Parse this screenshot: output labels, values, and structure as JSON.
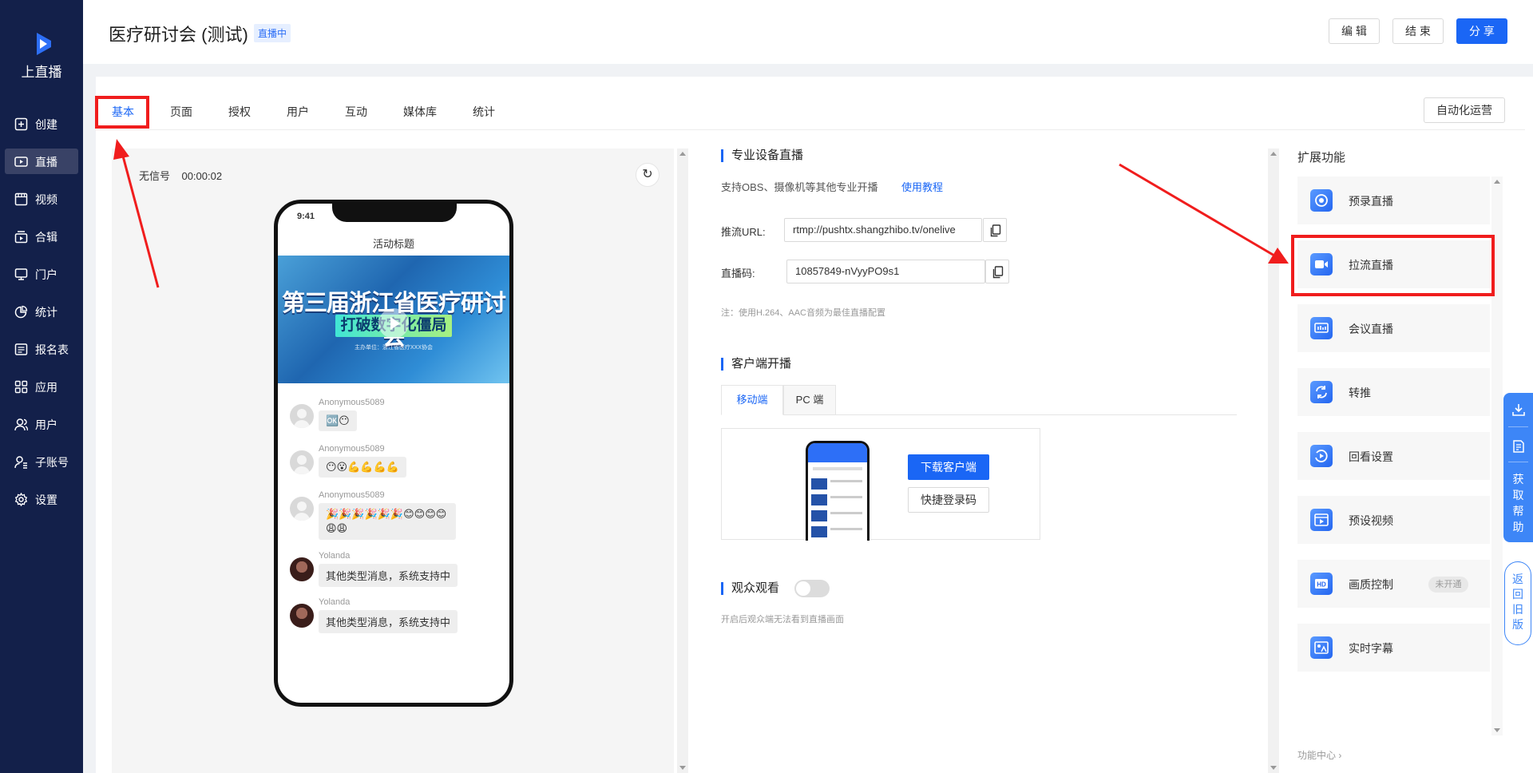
{
  "brand": {
    "name": "上直播"
  },
  "sidebar": {
    "items": [
      {
        "label": "创建",
        "icon": "plus-square-icon"
      },
      {
        "label": "直播",
        "icon": "video-icon",
        "active": true
      },
      {
        "label": "视频",
        "icon": "film-icon"
      },
      {
        "label": "合辑",
        "icon": "collection-icon"
      },
      {
        "label": "门户",
        "icon": "monitor-icon"
      },
      {
        "label": "统计",
        "icon": "pie-chart-icon"
      },
      {
        "label": "报名表",
        "icon": "form-icon"
      },
      {
        "label": "应用",
        "icon": "apps-icon"
      },
      {
        "label": "用户",
        "icon": "users-icon"
      },
      {
        "label": "子账号",
        "icon": "sub-account-icon"
      },
      {
        "label": "设置",
        "icon": "gear-icon"
      }
    ]
  },
  "header": {
    "title": "医疗研讨会 (测试)",
    "status_badge": "直播中",
    "edit_label": "编 辑",
    "end_label": "结 束",
    "share_label": "分 享"
  },
  "tabs": [
    "基本",
    "页面",
    "授权",
    "用户",
    "互动",
    "媒体库",
    "统计"
  ],
  "active_tab": "基本",
  "auto_ops_label": "自动化运营",
  "preview": {
    "signal_status": "无信号",
    "duration": "00:00:02",
    "phone_time": "9:41",
    "activity_title": "活动标题",
    "banner": {
      "title": "第三届浙江省医疗研讨会",
      "subtitle": "打破数字化僵局",
      "host_line": "主办单位：浙江省医疗XXX协会"
    },
    "messages": [
      {
        "name": "Anonymous5089",
        "content": "🆗😶"
      },
      {
        "name": "Anonymous5089",
        "content": "😶😮💪💪💪💪"
      },
      {
        "name": "Anonymous5089",
        "content": "🎉🎉🎉🎉🎉🎉😊😊😊😊😩😩"
      },
      {
        "name": "Yolanda",
        "content": "其他类型消息，系统支持中"
      },
      {
        "name": "Yolanda",
        "content": "其他类型消息，系统支持中"
      }
    ]
  },
  "pro_device": {
    "title": "专业设备直播",
    "description": "支持OBS、摄像机等其他专业开播",
    "tutorial_link": "使用教程",
    "push_url_label": "推流URL:",
    "push_url": "rtmp://pushtx.shangzhibo.tv/onelive",
    "stream_code_label": "直播码:",
    "stream_code": "10857849-nVyyPO9s1",
    "note": "注：使用H.264、AAC音频为最佳直播配置"
  },
  "client": {
    "title": "客户端开播",
    "tabs": [
      "移动端",
      "PC 端"
    ],
    "download_label": "下载客户端",
    "login_code_label": "快捷登录码"
  },
  "audience": {
    "title": "观众观看",
    "enabled": false,
    "description": "开启后观众端无法看到直播画面"
  },
  "extensions": {
    "title": "扩展功能",
    "items": [
      {
        "label": "预录直播",
        "icon": "pre-record-icon"
      },
      {
        "label": "拉流直播",
        "icon": "pull-stream-icon"
      },
      {
        "label": "会议直播",
        "icon": "meeting-icon"
      },
      {
        "label": "转推",
        "icon": "relay-icon"
      },
      {
        "label": "回看设置",
        "icon": "replay-icon"
      },
      {
        "label": "预设视频",
        "icon": "preset-video-icon"
      },
      {
        "label": "画质控制",
        "icon": "hd-icon",
        "badge": "未开通"
      },
      {
        "label": "实时字幕",
        "icon": "subtitle-icon"
      }
    ],
    "footer_link": "功能中心 ›"
  },
  "floating": {
    "help_label": "获取帮助",
    "old_version_label": "返回旧版"
  },
  "colors": {
    "primary": "#1a66f5",
    "sidebar_bg": "#13204a",
    "highlight_red": "#f01d1d"
  }
}
